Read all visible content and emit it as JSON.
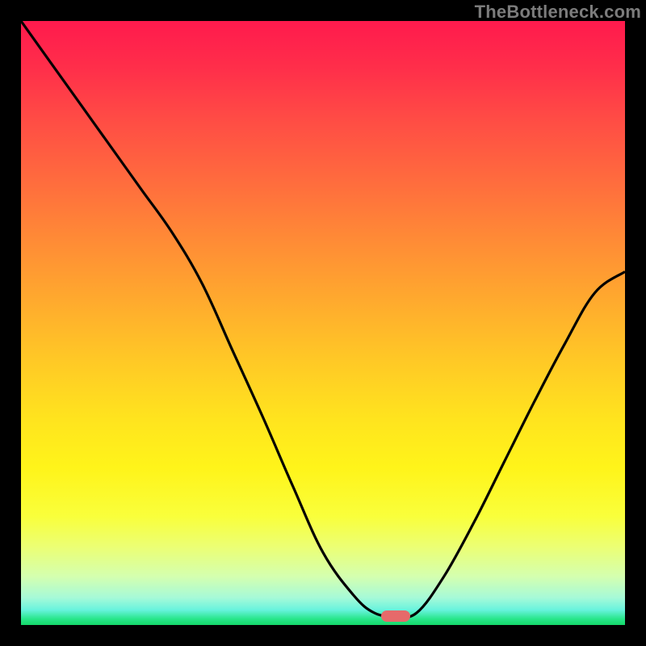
{
  "watermark": "TheBottleneck.com",
  "marker": {
    "cx_frac": 0.62,
    "cy_frac": 0.983
  },
  "colors": {
    "curve_stroke": "#000000",
    "marker_fill": "#e66a6a"
  },
  "chart_data": {
    "type": "line",
    "title": "",
    "xlabel": "",
    "ylabel": "",
    "x": [
      0.0,
      0.05,
      0.1,
      0.15,
      0.2,
      0.25,
      0.3,
      0.35,
      0.4,
      0.45,
      0.5,
      0.55,
      0.585,
      0.62,
      0.655,
      0.7,
      0.75,
      0.8,
      0.85,
      0.9,
      0.95,
      1.0
    ],
    "values": [
      1.0,
      0.93,
      0.86,
      0.79,
      0.72,
      0.65,
      0.565,
      0.455,
      0.345,
      0.23,
      0.12,
      0.05,
      0.02,
      0.015,
      0.02,
      0.08,
      0.17,
      0.27,
      0.37,
      0.465,
      0.55,
      0.585
    ],
    "xlim": [
      0,
      1
    ],
    "ylim": [
      0,
      1
    ],
    "note": "x and y are fractions of the plotting area (0–1). y=0 is bottom, y=1 is top. Minimum ≈ x 0.62, y ≈ 0.015."
  }
}
